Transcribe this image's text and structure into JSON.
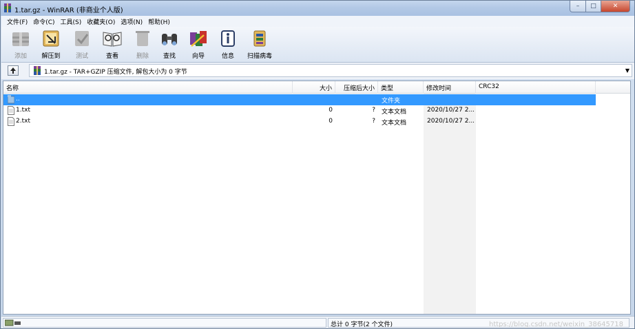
{
  "window": {
    "title": "1.tar.gz - WinRAR (非商业个人版)",
    "caption_buttons": {
      "minimize": "–",
      "maximize": "□",
      "close": "✕"
    }
  },
  "menu": [
    "文件(F)",
    "命令(C)",
    "工具(S)",
    "收藏夹(O)",
    "选项(N)",
    "帮助(H)"
  ],
  "toolbar": [
    {
      "label": "添加",
      "icon": "add-icon",
      "enabled": false
    },
    {
      "label": "解压到",
      "icon": "extract-icon",
      "enabled": true
    },
    {
      "label": "测试",
      "icon": "test-icon",
      "enabled": false
    },
    {
      "label": "查看",
      "icon": "view-icon",
      "enabled": true
    },
    {
      "label": "删除",
      "icon": "delete-icon",
      "enabled": false
    },
    {
      "label": "查找",
      "icon": "find-icon",
      "enabled": true
    },
    {
      "label": "向导",
      "icon": "wizard-icon",
      "enabled": true
    },
    {
      "label": "信息",
      "icon": "info-icon",
      "enabled": true
    },
    {
      "label": "扫描病毒",
      "icon": "virus-scan-icon",
      "enabled": true
    }
  ],
  "address": {
    "text": "1.tar.gz - TAR+GZIP 压缩文件, 解包大小为 0 字节"
  },
  "columns": {
    "name": "名称",
    "size": "大小",
    "packed": "压缩后大小",
    "type": "类型",
    "modified": "修改时间",
    "crc": "CRC32"
  },
  "rows": [
    {
      "name": "..",
      "size": "",
      "packed": "",
      "type": "文件夹",
      "modified": "",
      "crc": "",
      "icon": "folder-up-icon",
      "selected": true
    },
    {
      "name": "1.txt",
      "size": "0",
      "packed": "?",
      "type": "文本文档",
      "modified": "2020/10/27 2...",
      "crc": "",
      "icon": "text-file-icon",
      "selected": false
    },
    {
      "name": "2.txt",
      "size": "0",
      "packed": "?",
      "type": "文本文档",
      "modified": "2020/10/27 2...",
      "crc": "",
      "icon": "text-file-icon",
      "selected": false
    }
  ],
  "status": {
    "left": "",
    "right": "总计 0 字节(2 个文件)",
    "watermark": "https://blog.csdn.net/weixin_38645718"
  },
  "colors": {
    "selection": "#3399ff",
    "title_gradient": "#b3c9e6",
    "close_button": "#c7462d"
  }
}
